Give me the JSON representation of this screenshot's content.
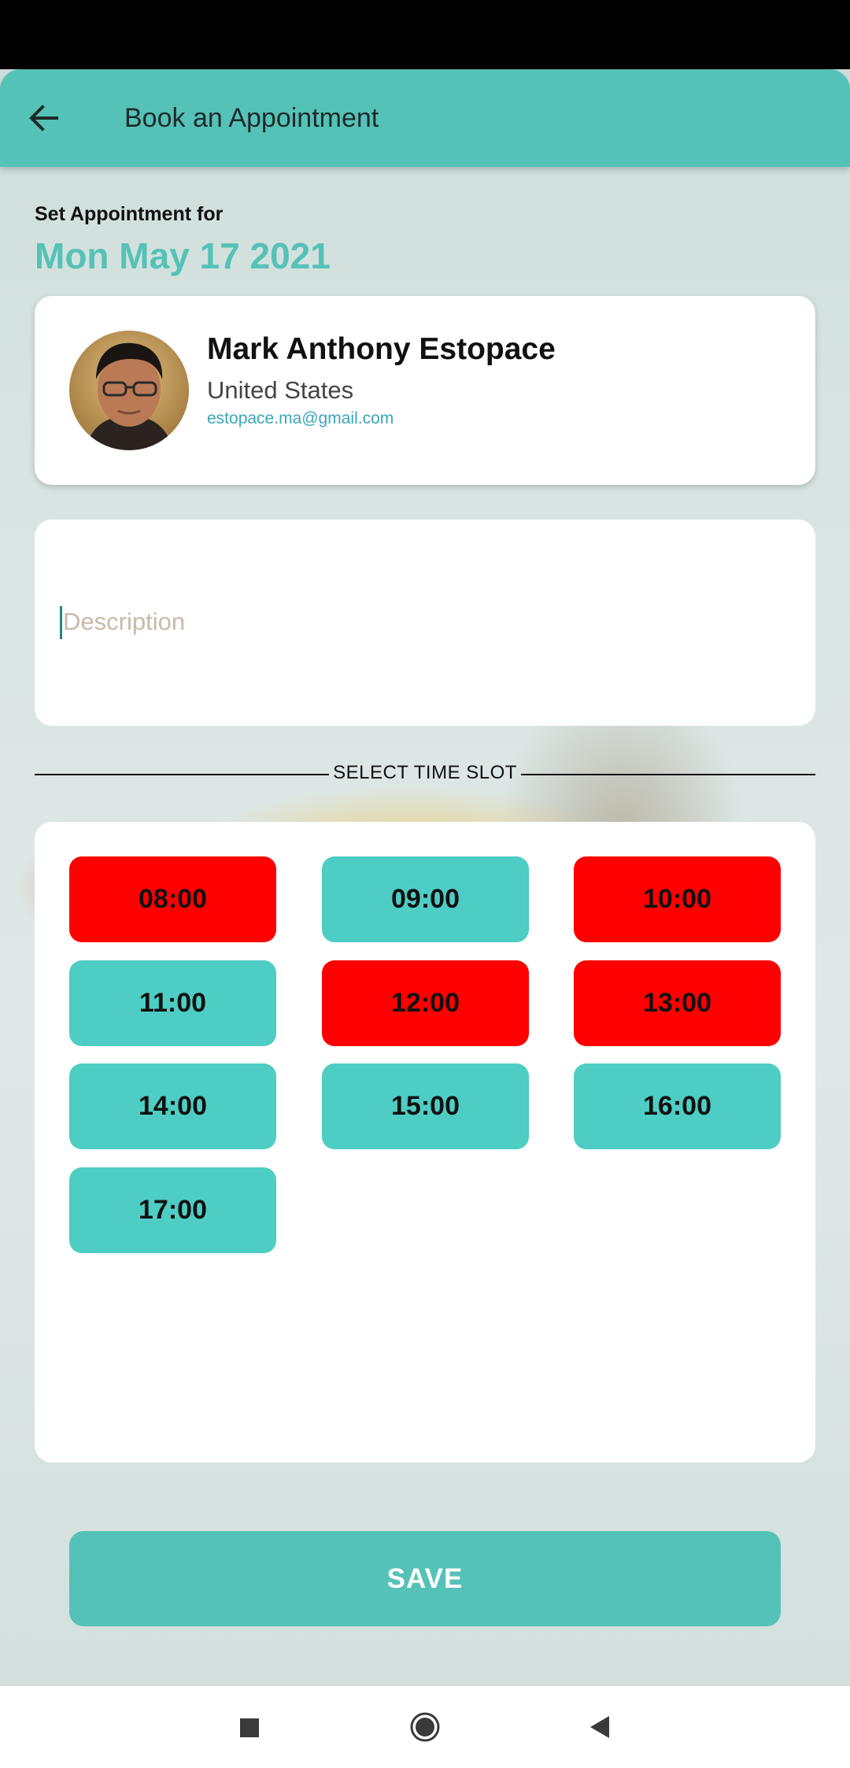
{
  "header": {
    "title": "Book an Appointment",
    "back_icon": "arrow-left-icon",
    "color": "#55c2b7"
  },
  "appointment": {
    "set_for_label": "Set Appointment for",
    "date": "Mon May 17 2021"
  },
  "profile": {
    "name": "Mark Anthony Estopace",
    "country": "United States",
    "email": "estopace.ma@gmail.com"
  },
  "description": {
    "placeholder": "Description",
    "value": ""
  },
  "time_slots": {
    "title": "SELECT TIME SLOT",
    "colors": {
      "available": "#4ecdc4",
      "booked": "#ff0000"
    },
    "slots": [
      {
        "time": "08:00",
        "status": "booked"
      },
      {
        "time": "09:00",
        "status": "available"
      },
      {
        "time": "10:00",
        "status": "booked"
      },
      {
        "time": "11:00",
        "status": "available"
      },
      {
        "time": "12:00",
        "status": "booked"
      },
      {
        "time": "13:00",
        "status": "booked"
      },
      {
        "time": "14:00",
        "status": "available"
      },
      {
        "time": "15:00",
        "status": "available"
      },
      {
        "time": "16:00",
        "status": "available"
      },
      {
        "time": "17:00",
        "status": "available"
      }
    ]
  },
  "actions": {
    "save_label": "SAVE"
  },
  "nav": {
    "icons": [
      "recent-apps-icon",
      "home-icon",
      "back-triangle-icon"
    ]
  }
}
